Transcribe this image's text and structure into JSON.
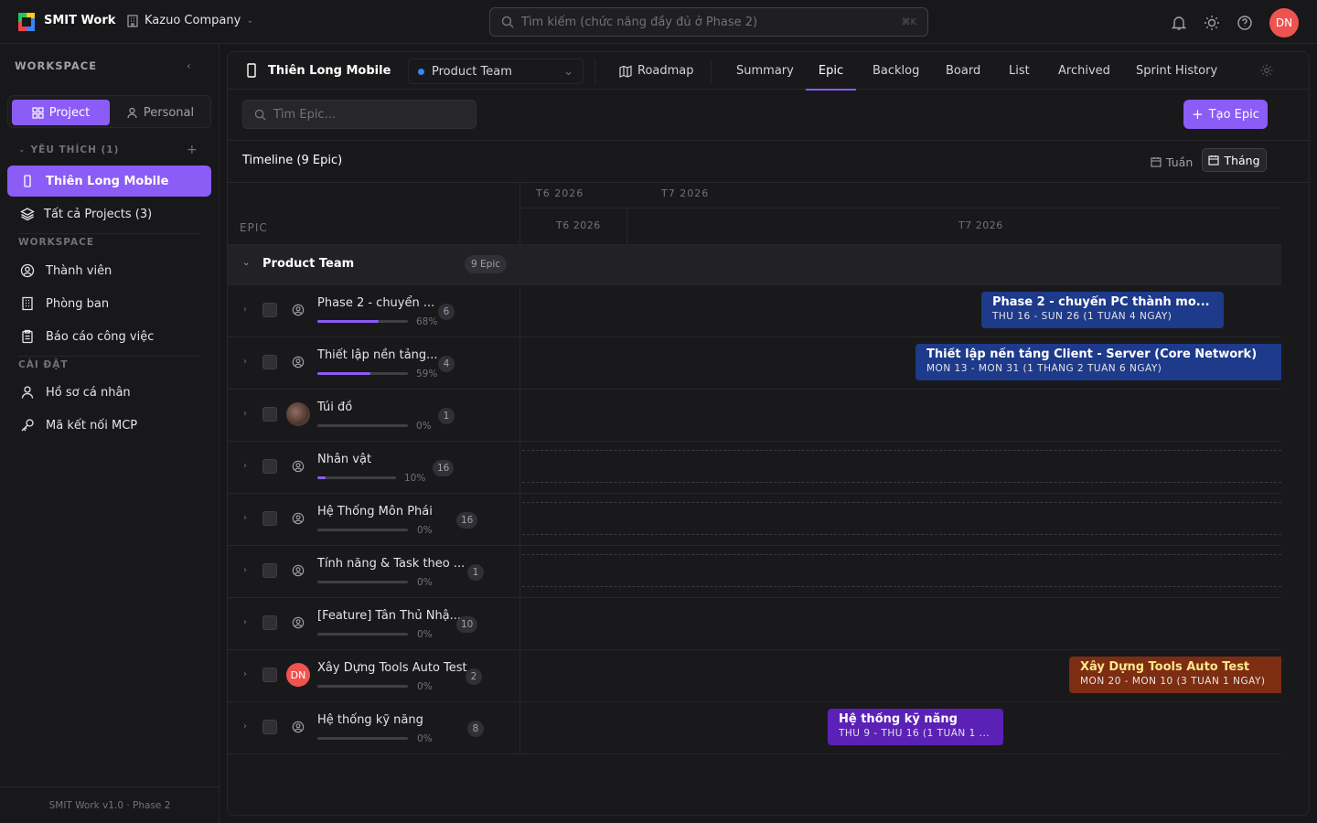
{
  "topbar": {
    "brand": "SMIT Work",
    "company": "Kazuo Company",
    "search_placeholder": "Tìm kiếm (chức năng đầy đủ ở Phase 2)",
    "search_shortcut": "⌘K",
    "avatar_initials": "DN"
  },
  "sidebar": {
    "title": "WORKSPACE",
    "seg_project": "Project",
    "seg_personal": "Personal",
    "favorites_label": "YÊU THÍCH (1)",
    "active_project": "Thiên Long Mobile",
    "all_projects": "Tất cả Projects (3)",
    "workspace_label": "WORKSPACE",
    "members": "Thành viên",
    "departments": "Phòng ban",
    "reports": "Báo cáo công việc",
    "settings_label": "CÀI ĐẶT",
    "profile": "Hồ sơ cá nhân",
    "mcp": "Mã kết nối MCP",
    "footer": "SMIT Work v1.0 · Phase 2"
  },
  "header": {
    "project_name": "Thiên Long Mobile",
    "team": "Product Team",
    "tabs": {
      "roadmap": "Roadmap",
      "summary": "Summary",
      "epic": "Epic",
      "backlog": "Backlog",
      "board": "Board",
      "list": "List",
      "archived": "Archived",
      "sprint_history": "Sprint History"
    }
  },
  "toolbar": {
    "search_placeholder": "Tìm Epic...",
    "create_label": "Tạo Epic"
  },
  "timeline": {
    "title": "Timeline (9 Epic)",
    "week_label": "Tuần",
    "month_label": "Tháng",
    "epic_col": "EPIC",
    "month_top_1": "T6 2026",
    "month_top_2": "T7 2026",
    "month_bot_1": "T6 2026",
    "month_bot_2": "T7 2026",
    "group_name": "Product Team",
    "group_count": "9 Epic"
  },
  "epics": [
    {
      "name": "Phase 2 - chuyển ...",
      "progress": 0.68,
      "pct": "68%",
      "count": "6",
      "owner": "user-icon"
    },
    {
      "name": "Thiết lập nền tảng...",
      "progress": 0.59,
      "pct": "59%",
      "count": "4",
      "owner": "user-icon"
    },
    {
      "name": "Túi đồ",
      "progress": 0,
      "pct": "0%",
      "count": "1",
      "owner": "photo-avatar"
    },
    {
      "name": "Nhân vật",
      "progress": 0.1,
      "pct": "10%",
      "count": "16",
      "owner": "user-icon"
    },
    {
      "name": "Hệ Thống Môn Phái",
      "progress": 0,
      "pct": "0%",
      "count": "16",
      "owner": "user-icon"
    },
    {
      "name": "Tính năng & Task theo ...",
      "progress": 0,
      "pct": "0%",
      "count": "1",
      "owner": "user-icon"
    },
    {
      "name": "[Feature] Tân Thủ Nhậ...",
      "progress": 0,
      "pct": "0%",
      "count": "10",
      "owner": "user-icon"
    },
    {
      "name": "Xây Dựng Tools Auto Test",
      "progress": 0,
      "pct": "0%",
      "count": "2",
      "owner": "DN"
    },
    {
      "name": "Hệ thống kỹ năng",
      "progress": 0,
      "pct": "0%",
      "count": "8",
      "owner": "user-icon"
    }
  ],
  "bars": [
    {
      "title": "Phase 2 - chuyển PC thành mo...",
      "dates": "THU 16 - SUN 26 (1 TUẦN 4 NGÀY)",
      "color": "#1e3a8a"
    },
    {
      "title": "Thiết lập nền tảng Client - Server (Core Network)",
      "dates": "MON 13 - MON 31 (1 THÁNG 2 TUẦN 6 NGÀY)",
      "color": "#1e3a8a"
    },
    {
      "title": "Xây Dựng Tools Auto Test",
      "dates": "MON 20 - MON 10 (3 TUẦN 1 NGÀY)",
      "color": "#7c2d12"
    },
    {
      "title": "Hệ thống kỹ năng",
      "dates": "THU 9 - THU 16 (1 TUẦN 1 ...",
      "color": "#5b21b6"
    }
  ],
  "colors": {
    "accent": "#8b5cf6",
    "background": "#17171a"
  }
}
